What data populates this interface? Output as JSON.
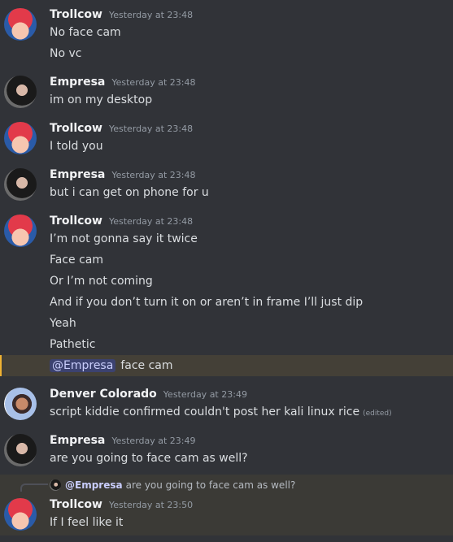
{
  "messages": [
    {
      "author": "Trollcow",
      "time": "Yesterday at 23:48",
      "lines": [
        "No face cam",
        "No vc"
      ]
    },
    {
      "author": "Empresa",
      "time": "Yesterday at 23:48",
      "lines": [
        "im on my desktop"
      ]
    },
    {
      "author": "Trollcow",
      "time": "Yesterday at 23:48",
      "lines": [
        "I told you"
      ]
    },
    {
      "author": "Empresa",
      "time": "Yesterday at 23:48",
      "lines": [
        "but i can get on phone for u"
      ]
    },
    {
      "author": "Trollcow",
      "time": "Yesterday at 23:48",
      "lines": [
        "I’m not gonna say it twice",
        "Face cam",
        "Or I’m not coming",
        "And if you don’t turn it on or aren’t in frame I’ll just dip",
        "Yeah",
        "Pathetic"
      ],
      "mention": "@Empresa",
      "mention_text": "face cam"
    },
    {
      "author": "Denver Colorado",
      "time": "Yesterday at 23:49",
      "lines": [
        "script kiddie confirmed couldn't post her kali linux rice"
      ],
      "edited": "(edited)"
    },
    {
      "author": "Empresa",
      "time": "Yesterday at 23:49",
      "lines": [
        "are you going to face cam as well?"
      ]
    },
    {
      "author": "Trollcow",
      "time": "Yesterday at 23:50",
      "lines": [
        "If I feel like it"
      ],
      "reply": {
        "mention": "@Empresa",
        "text": "are you going to face cam as well?"
      }
    }
  ]
}
